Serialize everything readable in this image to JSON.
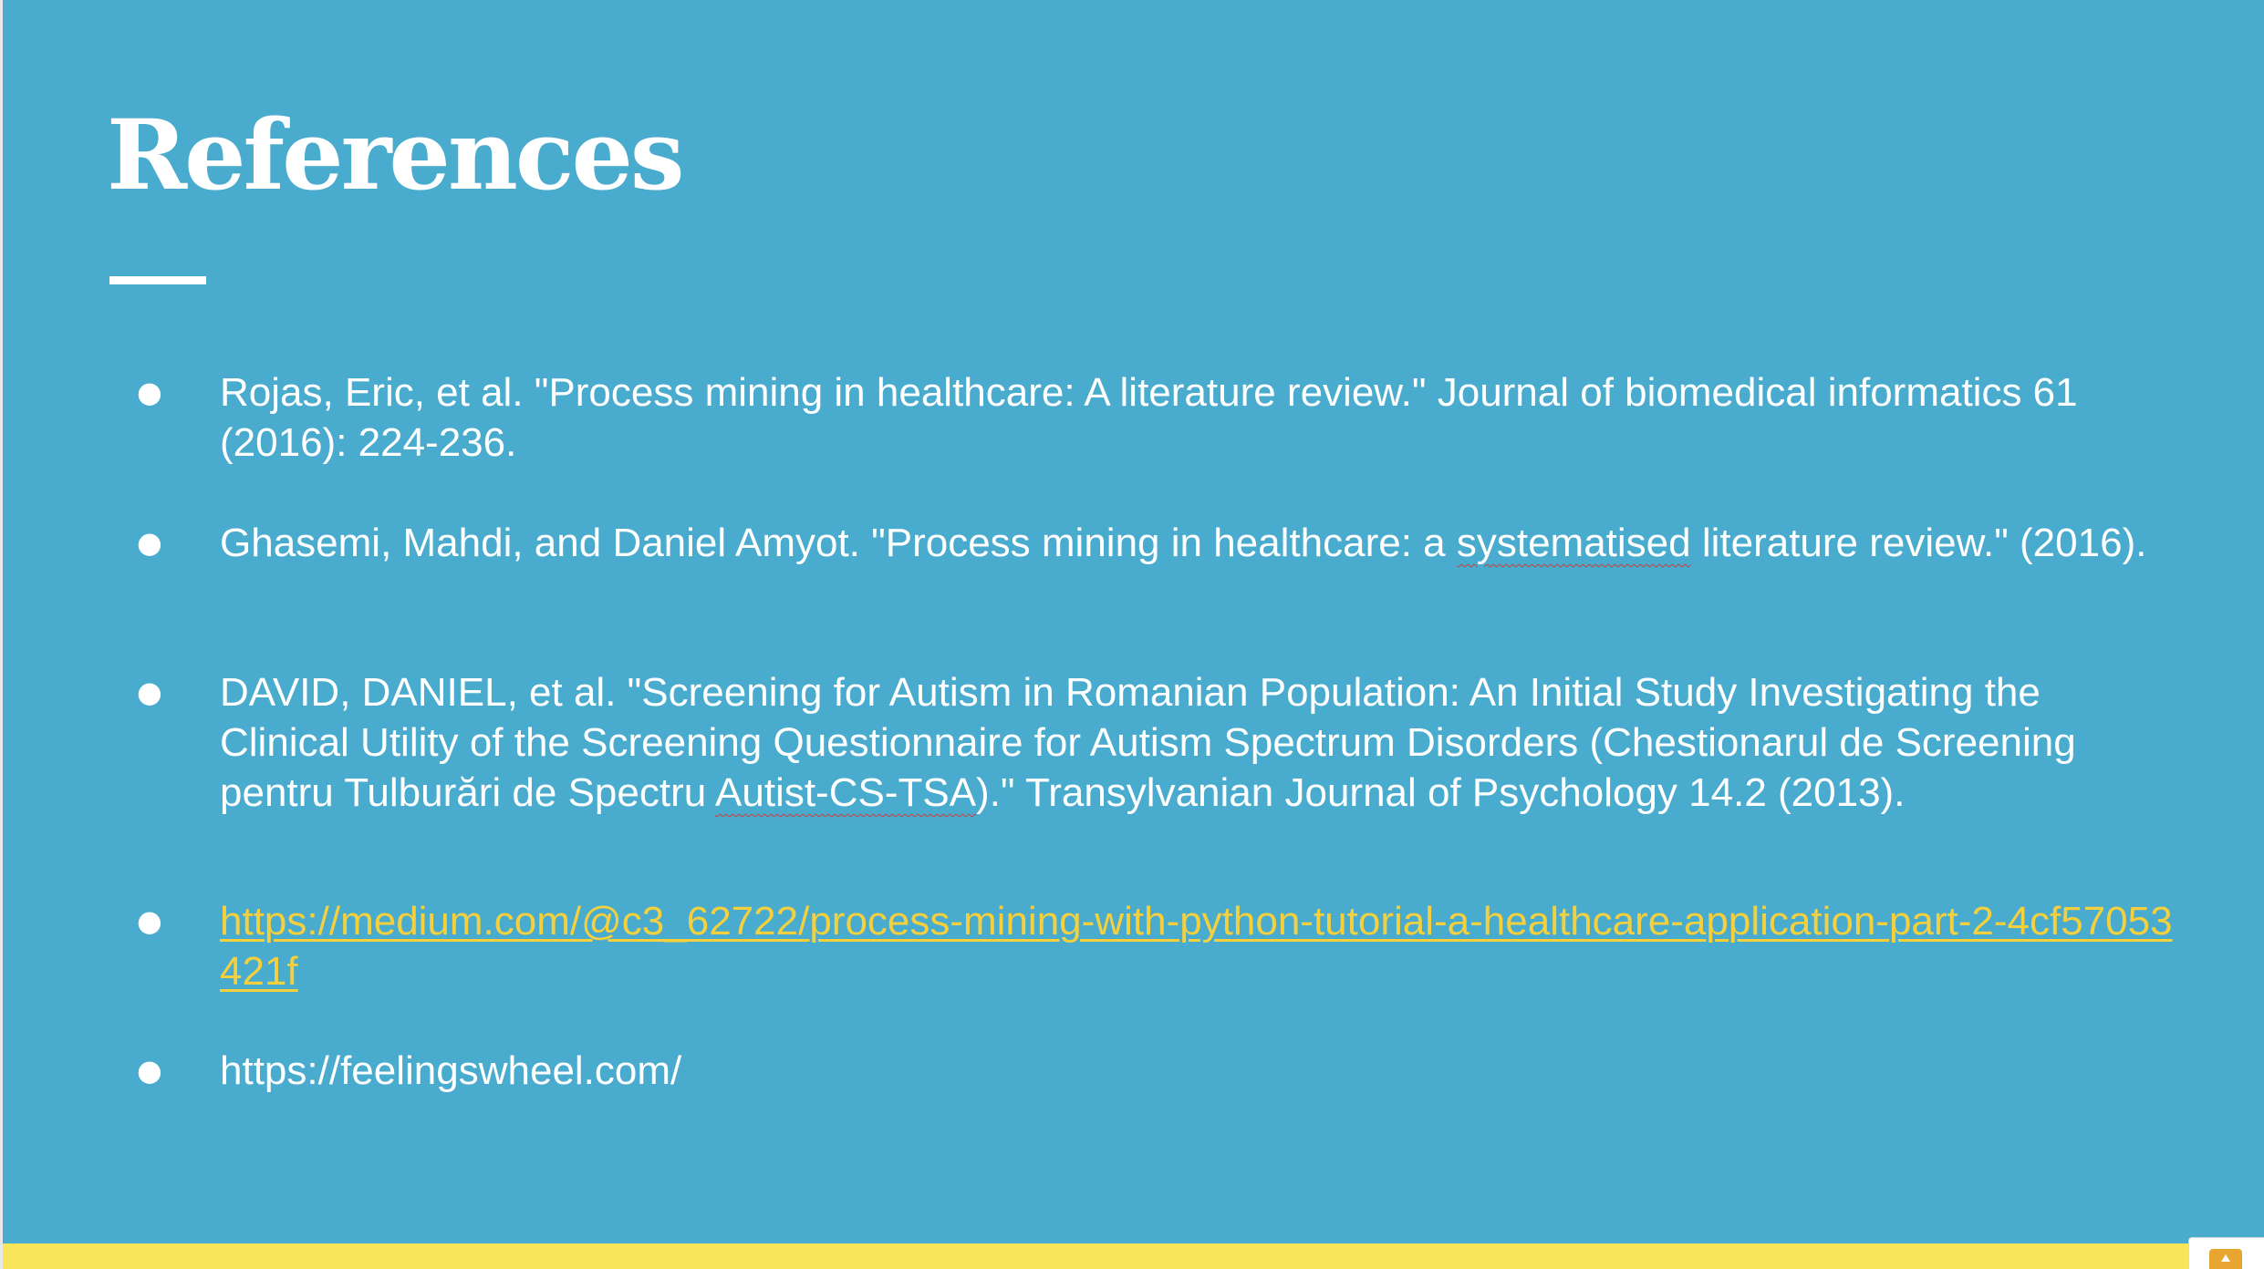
{
  "slide": {
    "title": "References",
    "colors": {
      "background": "#49abcd",
      "text": "#ffffff",
      "link": "#f4d03f",
      "footer_bar": "#f8e55a"
    },
    "references": [
      {
        "bullet": "●",
        "text": "Rojas, Eric, et al. \"Process mining in healthcare: A literature review.\" Journal of biomedical informatics 61 (2016): 224-236."
      },
      {
        "bullet": "●",
        "before": "Ghasemi, Mahdi, and Daniel Amyot. \"Process mining in healthcare: a ",
        "flagged": "systematised",
        "after": " literature review.\" (2016)."
      },
      {
        "bullet": "●",
        "before": "DAVID, DANIEL, et al. \"Screening for Autism in Romanian Population: An Initial Study Investigating the Clinical Utility of the Screening Questionnaire for Autism Spectrum Disorders (Chestionarul de Screening pentru Tulburări de Spectru ",
        "flagged": "Autist-CS-TSA",
        "after": ").\" Transylvanian Journal of Psychology 14.2 (2013)."
      },
      {
        "bullet": "●",
        "link": "https://medium.com/@c3_62722/process-mining-with-python-tutorial-a-healthcare-application-part-2-4cf57053421f"
      },
      {
        "bullet": "●",
        "text": "https://feelingswheel.com/"
      }
    ]
  }
}
